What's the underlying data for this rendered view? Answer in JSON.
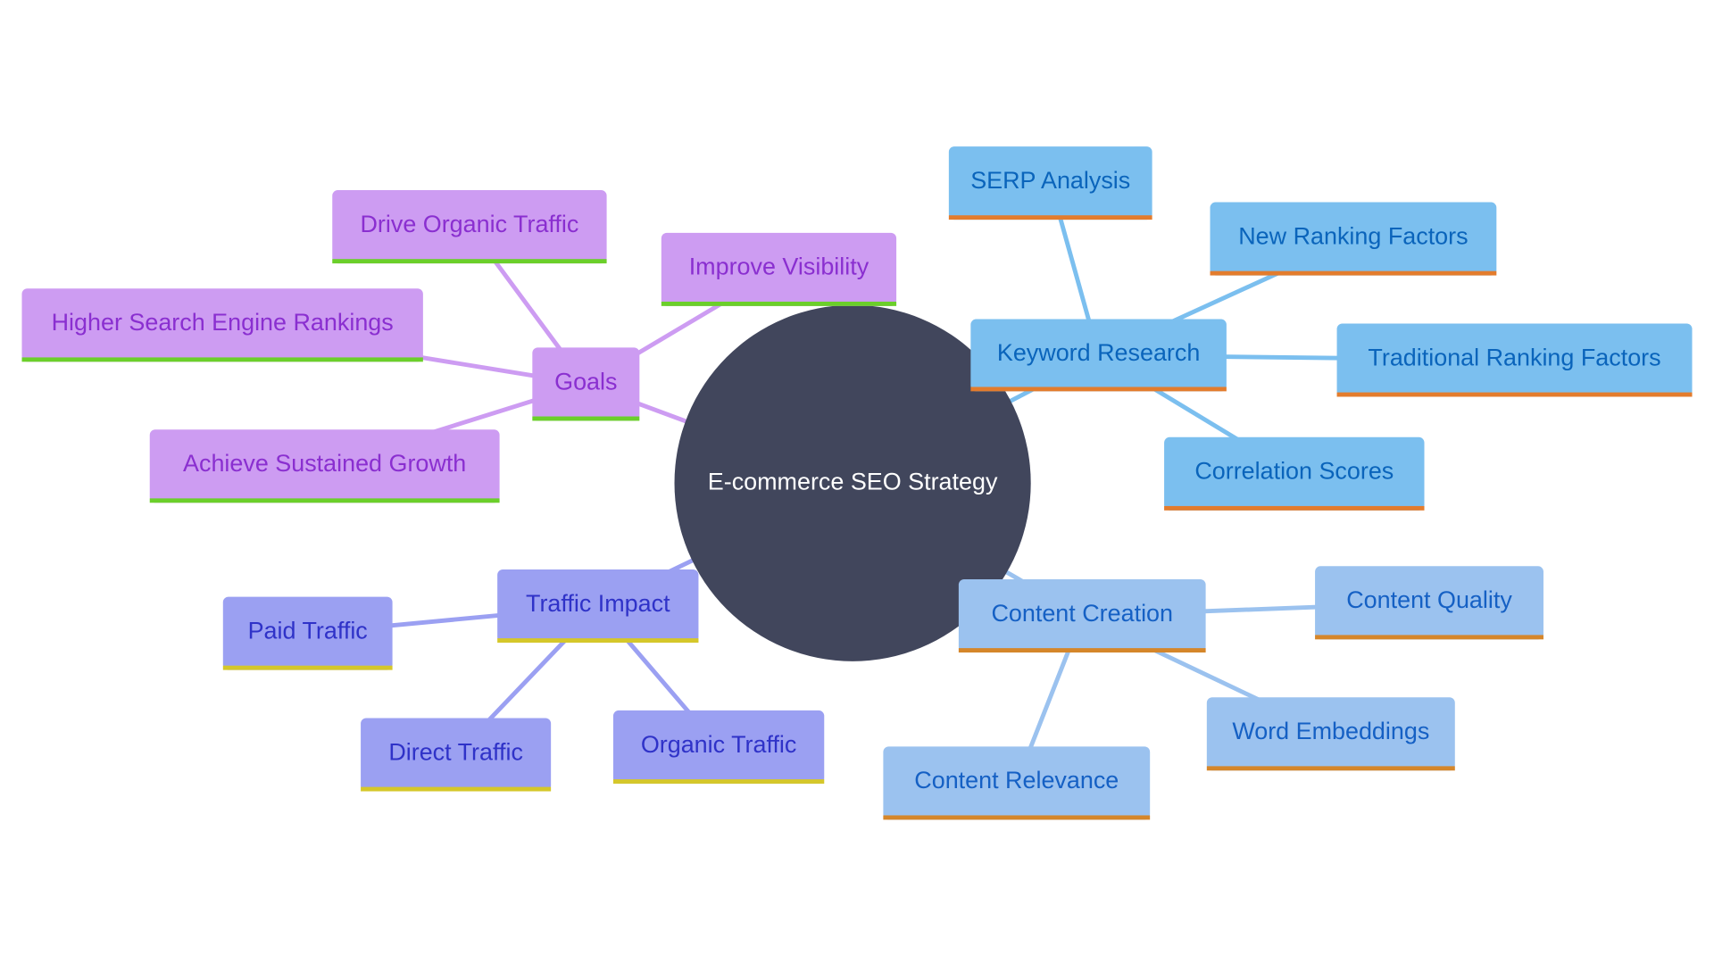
{
  "title": "E-commerce SEO Strategy",
  "colors": {
    "background": "#ffffff",
    "root_fill": "#41465c",
    "root_text": "#ffffff",
    "goals": {
      "fill": "#cd9cf2",
      "text": "#8a2fd0",
      "underline": "#6bcf2a",
      "edge": "#cd9cf2"
    },
    "keyword": {
      "fill": "#7bbfef",
      "text": "#0a64bb",
      "underline": "#e37c2d",
      "edge": "#7bbfef"
    },
    "content": {
      "fill": "#9bc2ef",
      "text": "#1560c4",
      "underline": "#d5862a",
      "edge": "#9bc2ef"
    },
    "traffic": {
      "fill": "#9ba0f2",
      "text": "#2f32c8",
      "underline": "#d5c72a",
      "edge": "#9ba0f2"
    }
  },
  "root": {
    "id": "root",
    "label": "E-commerce SEO Strategy"
  },
  "branches": [
    {
      "id": "goals",
      "label": "Goals",
      "theme": "goals",
      "children": [
        {
          "id": "drive-organic-traffic",
          "label": "Drive Organic Traffic"
        },
        {
          "id": "improve-visibility",
          "label": "Improve Visibility"
        },
        {
          "id": "higher-search-engine-rankings",
          "label": "Higher Search Engine Rankings"
        },
        {
          "id": "achieve-sustained-growth",
          "label": "Achieve Sustained Growth"
        }
      ]
    },
    {
      "id": "keyword-research",
      "label": "Keyword Research",
      "theme": "keyword",
      "children": [
        {
          "id": "serp-analysis",
          "label": "SERP Analysis"
        },
        {
          "id": "new-ranking-factors",
          "label": "New Ranking Factors"
        },
        {
          "id": "traditional-ranking-factors",
          "label": "Traditional Ranking Factors"
        },
        {
          "id": "correlation-scores",
          "label": "Correlation Scores"
        }
      ]
    },
    {
      "id": "content-creation",
      "label": "Content Creation",
      "theme": "content",
      "children": [
        {
          "id": "content-quality",
          "label": "Content Quality"
        },
        {
          "id": "word-embeddings",
          "label": "Word Embeddings"
        },
        {
          "id": "content-relevance",
          "label": "Content Relevance"
        }
      ]
    },
    {
      "id": "traffic-impact",
      "label": "Traffic Impact",
      "theme": "traffic",
      "children": [
        {
          "id": "paid-traffic",
          "label": "Paid Traffic"
        },
        {
          "id": "direct-traffic",
          "label": "Direct Traffic"
        },
        {
          "id": "organic-traffic",
          "label": "Organic Traffic"
        }
      ]
    }
  ]
}
